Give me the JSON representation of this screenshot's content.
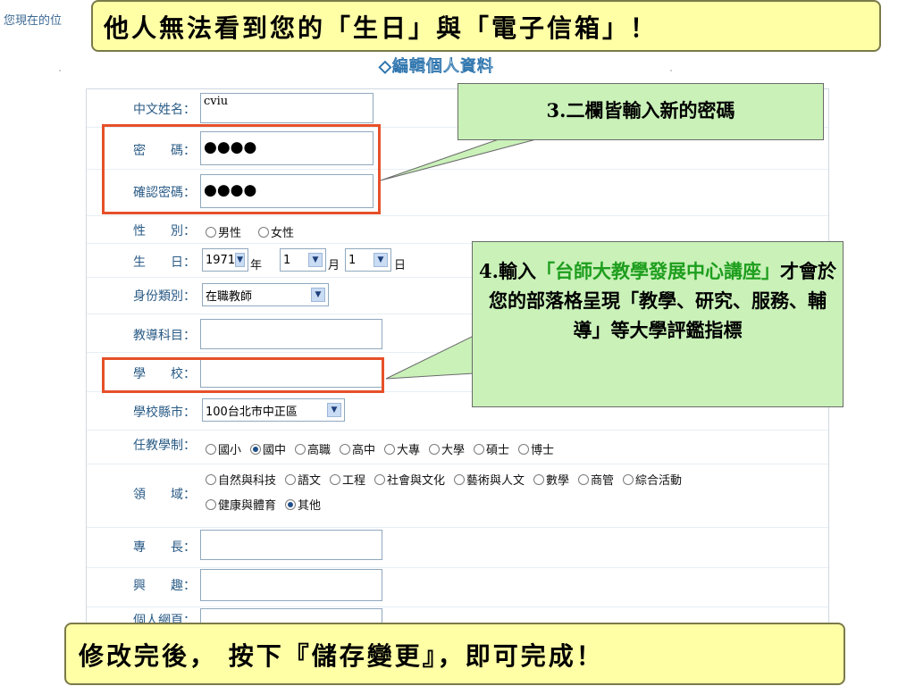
{
  "breadcrumb": "您現在的位",
  "section_title": "◇編輯個人資料",
  "form": {
    "name": {
      "label": "中文姓名：",
      "value": "cviu"
    },
    "password": {
      "label": "密　　碼：",
      "value": "●●●●"
    },
    "confirm_password": {
      "label": "確認密碼：",
      "value": "●●●●"
    },
    "gender": {
      "label": "性　　別：",
      "options": [
        "男性",
        "女性"
      ]
    },
    "birthday": {
      "label": "生　　日：",
      "year": "1971",
      "year_unit": "年",
      "month": "1",
      "month_unit": "月",
      "day": "1",
      "day_unit": "日"
    },
    "identity": {
      "label": "身份類別：",
      "value": "在職教師"
    },
    "subject": {
      "label": "教導科目：",
      "value": ""
    },
    "school": {
      "label": "學　　校：",
      "value": ""
    },
    "school_city": {
      "label": "學校縣市：",
      "value": "100台北市中正區"
    },
    "teaching_level": {
      "label": "任教學制：",
      "options": [
        "國小",
        "國中",
        "高職",
        "高中",
        "大專",
        "大學",
        "碩士",
        "博士"
      ],
      "selected": "國中"
    },
    "domain": {
      "label": "領　　域：",
      "options_line1": [
        "自然與科技",
        "語文",
        "工程",
        "社會與文化",
        "藝術與人文",
        "數學",
        "商管",
        "綜合活動"
      ],
      "options_line2": [
        "健康與體育",
        "其他"
      ],
      "selected": "其他"
    },
    "specialty": {
      "label": "專　　長：",
      "value": ""
    },
    "interest": {
      "label": "興　　趣：",
      "value": ""
    },
    "homepage": {
      "label": "個人網頁：",
      "value": ""
    }
  },
  "callouts": {
    "top": "他人無法看到您的「生日」與「電子信箱」！",
    "step3": "3.二欄皆輸入新的密碼",
    "step4_prefix": "4.輸入",
    "step4_highlight": "「台師大教學發展中心講座」",
    "step4_suffix": "才會於您的部落格呈現「教學、研究、服務、輔導」等大學評鑑指標",
    "bottom": "修改完後， 按下『儲存變更』，即可完成！"
  },
  "colors": {
    "highlight_box": "#e6502a",
    "note_bg": "#c9f1b8",
    "callout_bg": "#ffffa6",
    "label": "#2a5b86",
    "step4_highlight": "#1e9e1e"
  }
}
